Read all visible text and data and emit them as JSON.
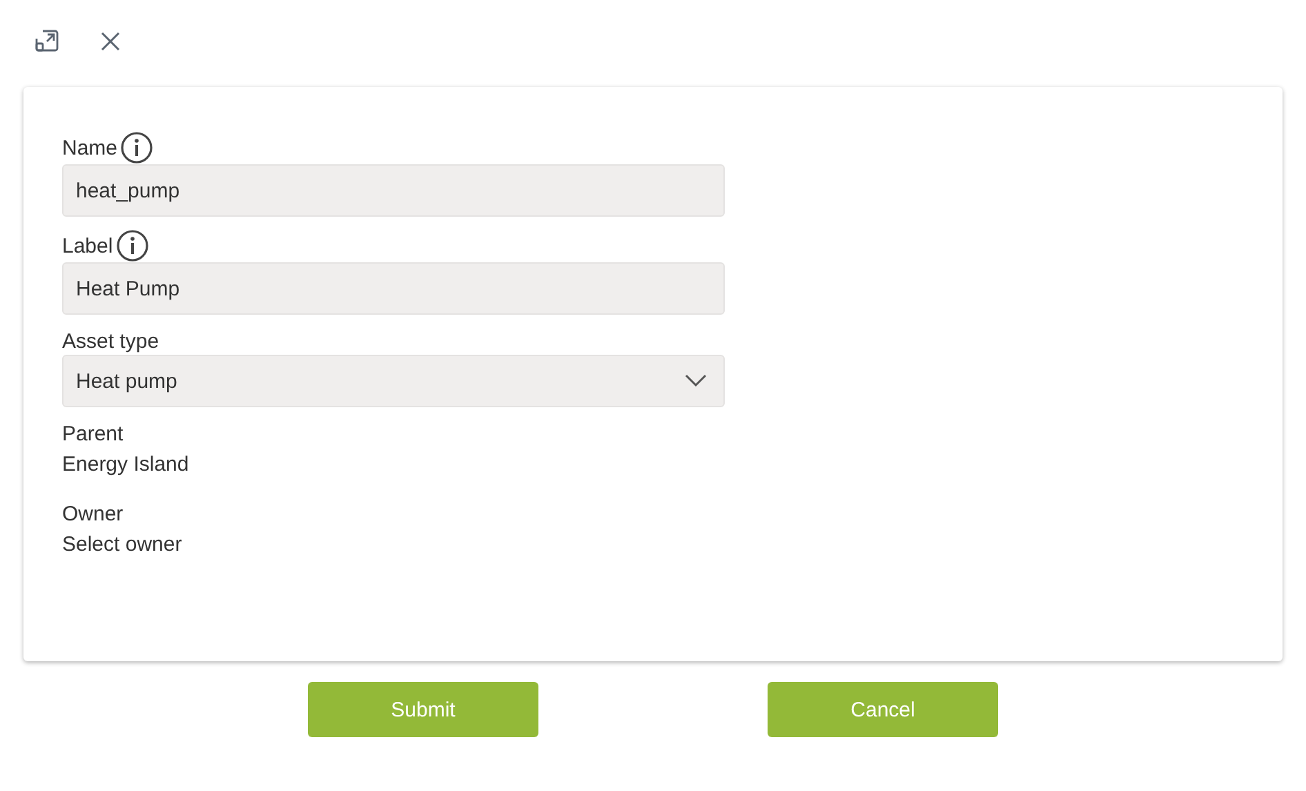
{
  "fields": [
    {
      "kind": "text",
      "label": "Name",
      "info": true,
      "value": "heat_pump"
    },
    {
      "kind": "text",
      "label": "Label",
      "info": true,
      "value": "Heat Pump"
    },
    {
      "kind": "select",
      "label": "Asset type",
      "value": "Heat pump"
    },
    {
      "kind": "static",
      "label": "Parent",
      "value": "Energy Island"
    },
    {
      "kind": "static",
      "label": "Owner",
      "value": "Select owner"
    }
  ],
  "buttons": [
    "Submit",
    "Cancel"
  ]
}
